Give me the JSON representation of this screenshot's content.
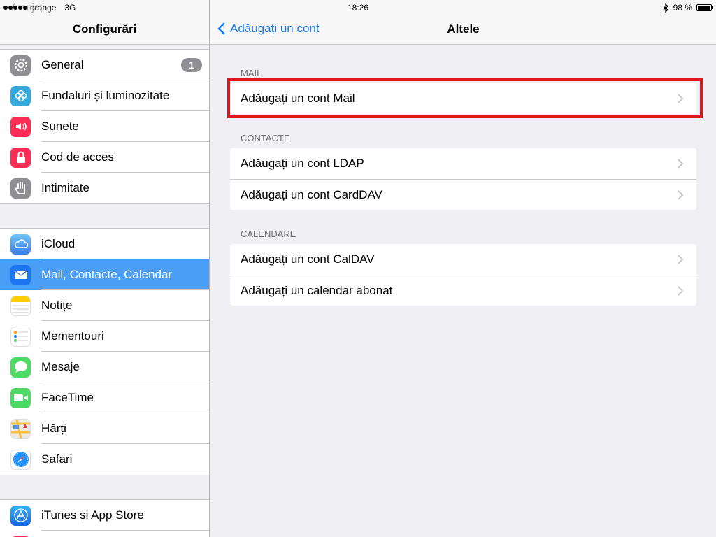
{
  "status_bar": {
    "carrier": "orange",
    "network": "3G",
    "time": "18:26",
    "battery": "98 %",
    "battery_level": 0.98
  },
  "sidebar": {
    "ghost_text": "Aranjați",
    "title": "Configurări",
    "groups": [
      [
        {
          "label": "General",
          "icon": "gear-icon",
          "color": "#8e8e93",
          "badge": "1"
        },
        {
          "label": "Fundaluri și luminozitate",
          "icon": "flower-icon",
          "color": "#34aadc"
        },
        {
          "label": "Sunete",
          "icon": "speaker-icon",
          "color": "#ff2d55"
        },
        {
          "label": "Cod de acces",
          "icon": "lock-icon",
          "color": "#ff2d55"
        },
        {
          "label": "Intimitate",
          "icon": "hand-icon",
          "color": "#8e8e93"
        }
      ],
      [
        {
          "label": "iCloud",
          "icon": "cloud-icon",
          "color": "#5ac8fa"
        },
        {
          "label": "Mail, Contacte, Calendar",
          "icon": "envelope-icon",
          "color": "#1d77f2",
          "selected": true
        },
        {
          "label": "Notițe",
          "icon": "notes-icon",
          "color": "#ffcc00"
        },
        {
          "label": "Mementouri",
          "icon": "reminders-icon",
          "color": "#ffffff"
        },
        {
          "label": "Mesaje",
          "icon": "message-icon",
          "color": "#4cd964"
        },
        {
          "label": "FaceTime",
          "icon": "camera-icon",
          "color": "#4cd964"
        },
        {
          "label": "Hărți",
          "icon": "map-icon",
          "color": "#e8e8e8"
        },
        {
          "label": "Safari",
          "icon": "compass-icon",
          "color": "#1e90ff"
        }
      ],
      [
        {
          "label": "iTunes și App Store",
          "icon": "appstore-icon",
          "color": "#1d8cf2"
        }
      ]
    ]
  },
  "navbar": {
    "back_label": "Adăugați un cont",
    "title": "Altele"
  },
  "sections": [
    {
      "header": "MAIL",
      "rows": [
        "Adăugați un cont Mail"
      ]
    },
    {
      "header": "CONTACTE",
      "rows": [
        "Adăugați un cont LDAP",
        "Adăugați un cont CardDAV"
      ]
    },
    {
      "header": "CALENDARE",
      "rows": [
        "Adăugați un cont CalDAV",
        "Adăugați un calendar abonat"
      ]
    }
  ],
  "colors": {
    "accent": "#157efb",
    "selected": "#4a9ef5",
    "highlight": "#e0161e"
  }
}
